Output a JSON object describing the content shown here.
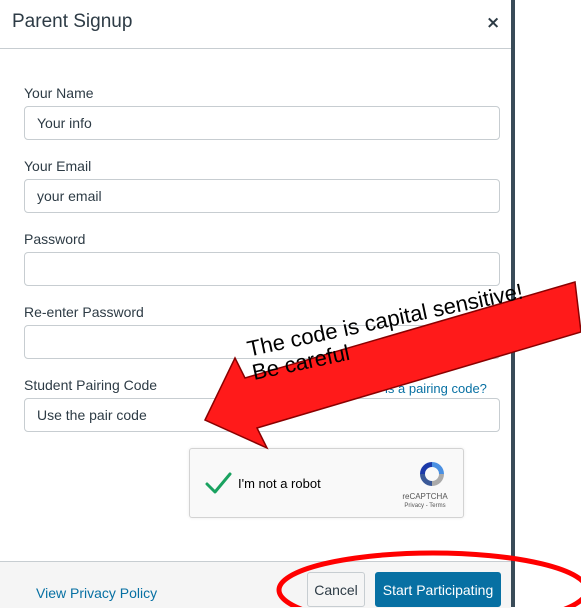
{
  "modal": {
    "title": "Parent Signup",
    "close_glyph": "×"
  },
  "form": {
    "name": {
      "label": "Your Name",
      "value": "Your info"
    },
    "email": {
      "label": "Your Email",
      "value": "your email"
    },
    "password": {
      "label": "Password",
      "value": ""
    },
    "password_confirm": {
      "label": "Re-enter Password",
      "value": ""
    },
    "pairing_code": {
      "label": "Student Pairing Code",
      "value": "Use the pair code",
      "help_link": "is a pairing code?"
    }
  },
  "recaptcha": {
    "label": "I'm not a robot",
    "brand": "reCAPTCHA",
    "links": "Privacy - Terms",
    "checked": true
  },
  "footer": {
    "privacy_link": "View Privacy Policy",
    "cancel_label": "Cancel",
    "start_label": "Start Participating"
  },
  "annotation": {
    "line1": "The code is capital sensitive!",
    "line2": "Be careful",
    "arrow_color": "#ff0000",
    "ellipse_color": "#ff0000"
  },
  "colors": {
    "link": "#0770a3",
    "primary_button": "#0770a3",
    "text": "#2d3b45"
  }
}
